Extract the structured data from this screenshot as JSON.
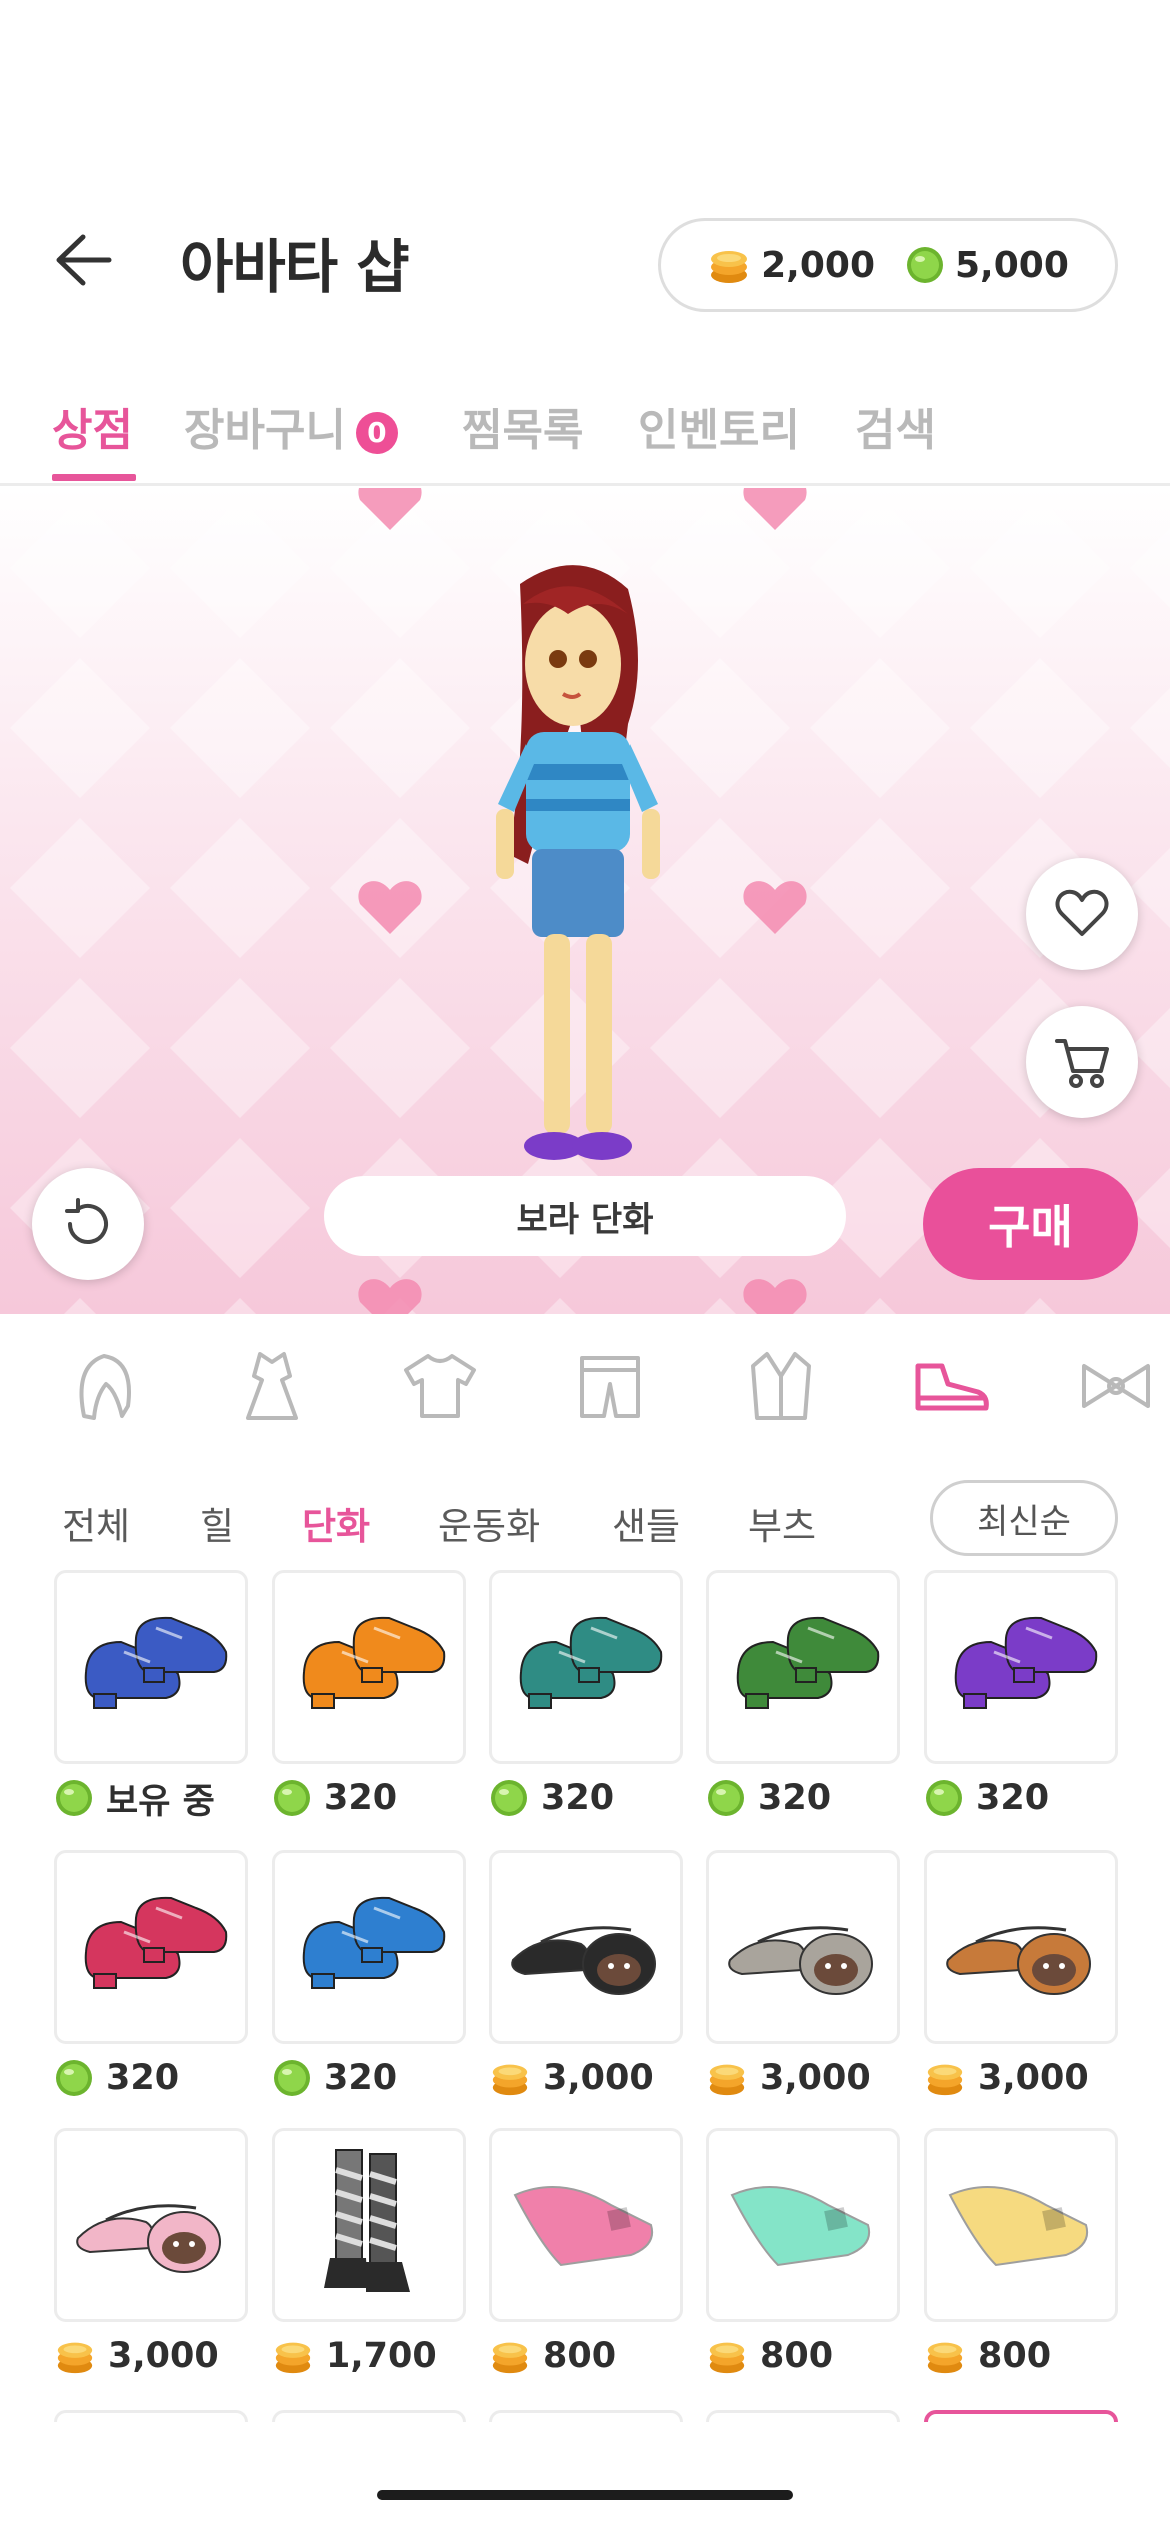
{
  "header": {
    "title": "아바타 샵",
    "gold_balance": "2,000",
    "gem_balance": "5,000"
  },
  "tabs": [
    {
      "label": "상점",
      "active": true
    },
    {
      "label": "장바구니",
      "badge": "0"
    },
    {
      "label": "찜목록"
    },
    {
      "label": "인벤토리"
    },
    {
      "label": "검색"
    }
  ],
  "preview": {
    "item_name": "보라 단화",
    "buy_label": "구매"
  },
  "categories": [
    "hair-icon",
    "dress-icon",
    "tshirt-icon",
    "pants-icon",
    "jacket-icon",
    "shoe-icon",
    "bow-icon"
  ],
  "filters": {
    "items": [
      "전체",
      "힐",
      "단화",
      "운동화",
      "샌들",
      "부츠"
    ],
    "active": "단화",
    "sort_label": "최신순"
  },
  "products": [
    {
      "kind": "shoe",
      "color": "#3b5bc4",
      "currency": "gem",
      "price": "보유 중"
    },
    {
      "kind": "shoe",
      "color": "#f08a1c",
      "currency": "gem",
      "price": "320"
    },
    {
      "kind": "shoe",
      "color": "#2f8c84",
      "currency": "gem",
      "price": "320"
    },
    {
      "kind": "shoe",
      "color": "#3f8a3a",
      "currency": "gem",
      "price": "320"
    },
    {
      "kind": "shoe",
      "color": "#7b3cc8",
      "currency": "gem",
      "price": "320"
    },
    {
      "kind": "shoe",
      "color": "#d5365e",
      "currency": "gem",
      "price": "320"
    },
    {
      "kind": "shoe",
      "color": "#2e7fd0",
      "currency": "gem",
      "price": "320"
    },
    {
      "kind": "flat",
      "color": "#2a2a2a",
      "currency": "gold",
      "price": "3,000"
    },
    {
      "kind": "flat",
      "color": "#a9a49c",
      "currency": "gold",
      "price": "3,000"
    },
    {
      "kind": "flat",
      "color": "#c77a3a",
      "currency": "gold",
      "price": "3,000"
    },
    {
      "kind": "flat",
      "color": "#f2b6c8",
      "currency": "gold",
      "price": "3,000"
    },
    {
      "kind": "boot",
      "color": "#2a2a2a",
      "currency": "gold",
      "price": "1,700"
    },
    {
      "kind": "slip",
      "color": "#f07aa6",
      "currency": "gold",
      "price": "800"
    },
    {
      "kind": "slip",
      "color": "#7ee3c6",
      "currency": "gold",
      "price": "800"
    },
    {
      "kind": "slip",
      "color": "#f6d97a",
      "currency": "gold",
      "price": "800"
    }
  ],
  "colors": {
    "accent": "#e7559a",
    "gem": "#7fc43a",
    "gold": "#f0a62a"
  }
}
